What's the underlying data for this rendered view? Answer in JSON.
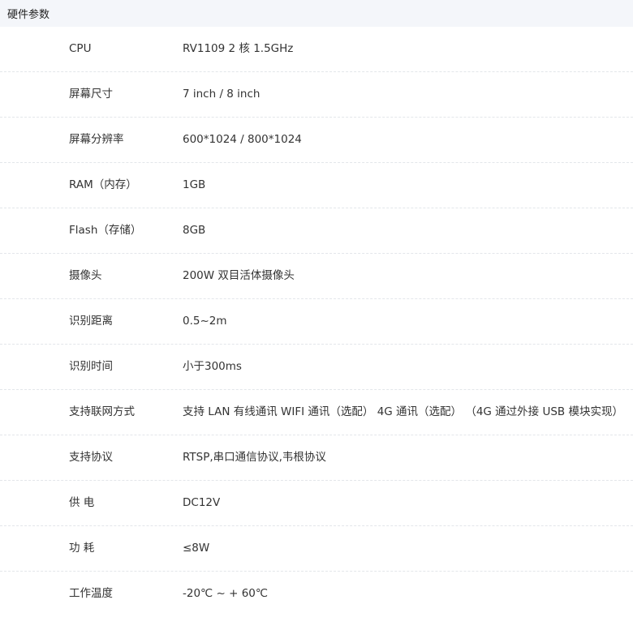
{
  "header": {
    "title": "硬件参数"
  },
  "specs": [
    {
      "label": "CPU",
      "value": "RV1109 2 核 1.5GHz"
    },
    {
      "label": "屏幕尺寸",
      "value": "7 inch / 8 inch"
    },
    {
      "label": "屏幕分辨率",
      "value": "600*1024 / 800*1024"
    },
    {
      "label": "RAM（内存）",
      "value": "1GB"
    },
    {
      "label": "Flash（存储）",
      "value": "8GB"
    },
    {
      "label": "摄像头",
      "value": "200W 双目活体摄像头"
    },
    {
      "label": "识别距离",
      "value": "0.5~2m"
    },
    {
      "label": "识别时间",
      "value": "小于300ms"
    },
    {
      "label": "支持联网方式",
      "value": "支持 LAN 有线通讯 WIFI 通讯（选配） 4G 通讯（选配） （4G 通过外接 USB 模块实现）"
    },
    {
      "label": "支持协议",
      "value": "RTSP,串口通信协议,韦根协议"
    },
    {
      "label": "供 电",
      "value": "DC12V"
    },
    {
      "label": "功 耗",
      "value": "≤8W"
    },
    {
      "label": "工作温度",
      "value": "-20℃ ~ + 60℃"
    }
  ]
}
